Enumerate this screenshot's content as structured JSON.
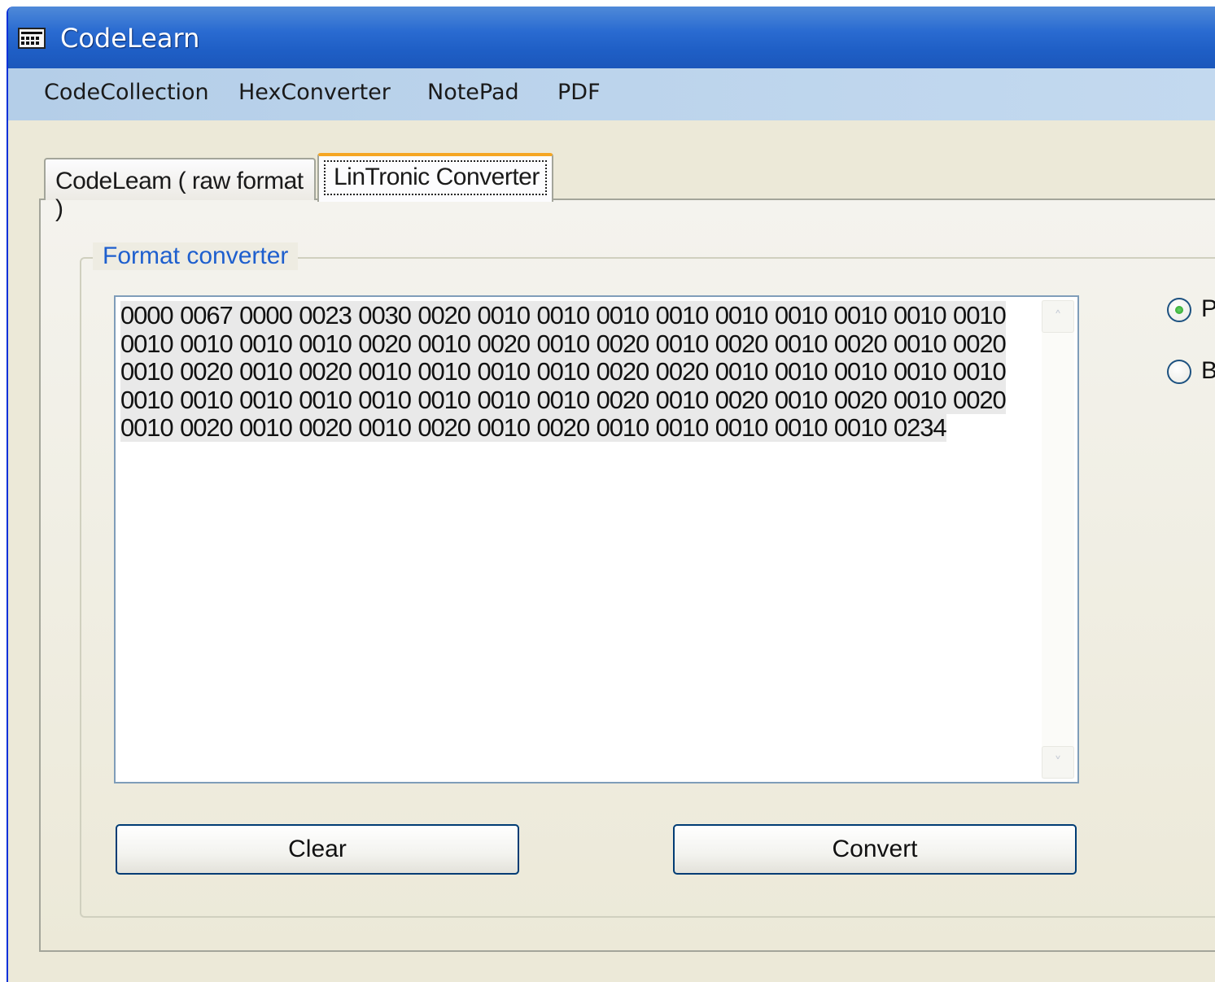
{
  "window": {
    "title": "CodeLearn"
  },
  "menu": {
    "items": [
      {
        "label": "CodeCollection"
      },
      {
        "label": "HexConverter"
      },
      {
        "label": "NotePad"
      },
      {
        "label": "PDF"
      }
    ]
  },
  "tabs": [
    {
      "label": "CodeLeam ( raw format )",
      "selected": false
    },
    {
      "label": "LinTronic Converter",
      "selected": true
    }
  ],
  "group": {
    "legend": "Format converter"
  },
  "code_text": {
    "lines": [
      "0000 0067 0000 0023 0030 0020 0010 0010 0010 0010 0010 0010 0010 0010 0010",
      "0010 0010 0010 0010 0020 0010 0020 0010 0020 0010 0020 0010 0020 0010 0020",
      "0010 0020 0010 0020 0010 0010 0010 0010 0020 0020 0010 0010 0010 0010 0010",
      "0010 0010 0010 0010 0010 0010 0010 0010 0020 0010 0020 0010 0020 0010 0020",
      "0010 0020 0010 0020 0010 0020 0010 0020 0010 0010 0010 0010 0010 0234"
    ]
  },
  "buttons": {
    "clear": "Clear",
    "convert": "Convert"
  },
  "radios": [
    {
      "label": "P",
      "checked": true
    },
    {
      "label": "B",
      "checked": false
    }
  ],
  "icons": {
    "app": "calculator-grid-icon",
    "scroll_up": "chevron-up-icon",
    "scroll_down": "chevron-down-icon"
  },
  "colors": {
    "title_bar": "#2a6bd1",
    "menu_bar": "#bcd4ec",
    "legend_text": "#1e5fce",
    "active_tab_accent": "#f5a623",
    "radio_dot": "#21a121"
  }
}
